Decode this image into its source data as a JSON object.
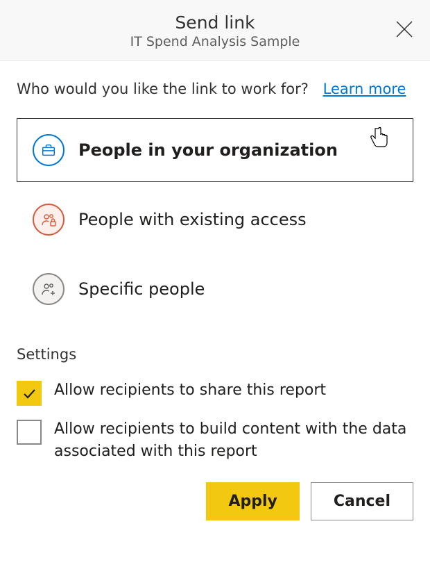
{
  "header": {
    "title": "Send link",
    "subtitle": "IT Spend Analysis Sample"
  },
  "prompt": "Who would you like the link to work for?",
  "learn_more": "Learn more",
  "options": {
    "org": "People in your organization",
    "existing": "People with existing access",
    "specific": "Specific people"
  },
  "settings": {
    "heading": "Settings",
    "allow_share": "Allow recipients to share this report",
    "allow_build": "Allow recipients to build content with the data associated with this report"
  },
  "buttons": {
    "apply": "Apply",
    "cancel": "Cancel"
  }
}
